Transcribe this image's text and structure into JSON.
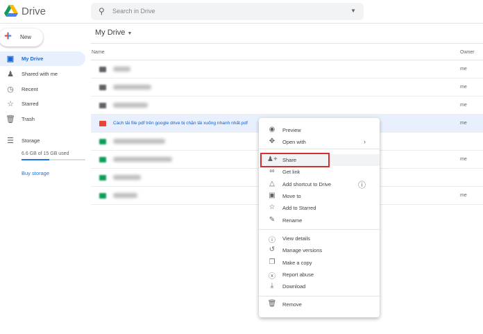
{
  "app": {
    "name": "Drive",
    "search_placeholder": "Search in Drive"
  },
  "sidebar": {
    "new_label": "New",
    "items": [
      {
        "label": "My Drive",
        "icon": "my-drive-icon",
        "active": true
      },
      {
        "label": "Shared with me",
        "icon": "people-icon"
      },
      {
        "label": "Recent",
        "icon": "clock-icon"
      },
      {
        "label": "Starred",
        "icon": "star-icon"
      },
      {
        "label": "Trash",
        "icon": "trash-icon"
      }
    ],
    "storage": {
      "label": "Storage",
      "usage": "6.6 GB of 15 GB used",
      "used_fraction": 0.44,
      "buy_label": "Buy storage"
    }
  },
  "main": {
    "title": "My Drive",
    "columns": {
      "name": "Name",
      "owner": "Owner"
    },
    "files": [
      {
        "type": "folder",
        "owner": "me"
      },
      {
        "type": "folder",
        "owner": "me"
      },
      {
        "type": "folder",
        "owner": "me"
      },
      {
        "type": "pdf",
        "name": "Cách tải file pdf trên google drive bị chặn tải xuống nhanh nhất.pdf",
        "owner": "me",
        "selected": true
      },
      {
        "type": "sheet",
        "owner": ""
      },
      {
        "type": "sheet",
        "owner": "me"
      },
      {
        "type": "sheet",
        "owner": ""
      },
      {
        "type": "sheet",
        "owner": "me"
      }
    ]
  },
  "context_menu": {
    "items": [
      "Preview",
      "Open with",
      "Share",
      "Get link",
      "Add shortcut to Drive",
      "Move to",
      "Add to Starred",
      "Rename",
      "View details",
      "Manage versions",
      "Make a copy",
      "Report abuse",
      "Download",
      "Remove"
    ],
    "highlighted": "Share",
    "highlight_color": "#d32f2f"
  }
}
